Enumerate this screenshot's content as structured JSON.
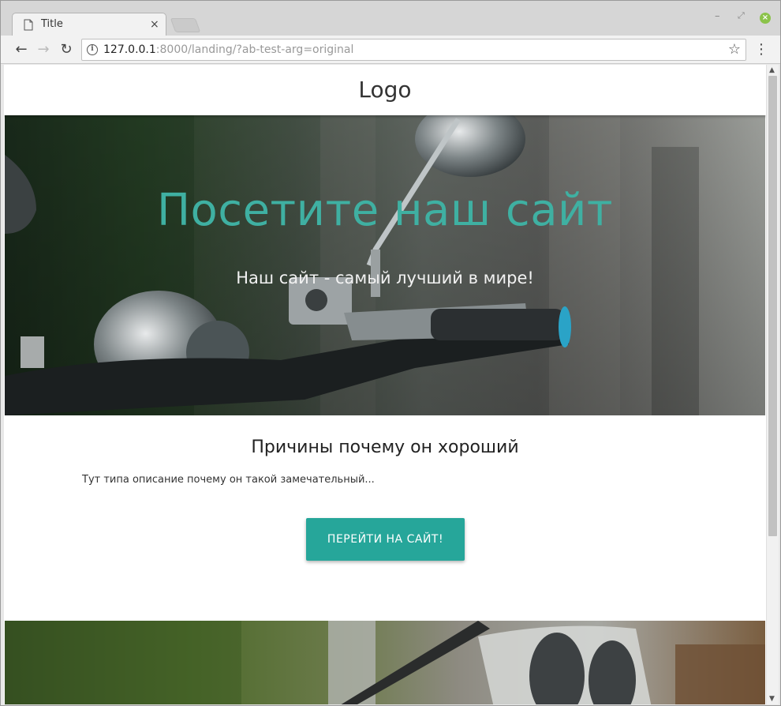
{
  "browser": {
    "tab_title": "Title",
    "tab_close": "×",
    "url_host": "127.0.0.1",
    "url_rest": ":8000/landing/?ab-test-arg=original",
    "icons": {
      "back": "back-arrow-icon",
      "forward": "forward-arrow-icon",
      "reload": "reload-icon",
      "info": "info-icon",
      "star": "star-icon",
      "menu": "menu-icon"
    }
  },
  "page": {
    "logo": "Logo",
    "hero": {
      "title": "Посетите наш сайт",
      "subtitle": "Наш сайт - самый лучший в мире!"
    },
    "section": {
      "title": "Причины почему он хороший",
      "text": "Тут типа описание почему он такой замечательный..."
    },
    "cta_label": "ПЕРЕЙТИ НА САЙТ!"
  },
  "colors": {
    "accent": "#26a69a",
    "hero_title": "#3fb0a2"
  }
}
